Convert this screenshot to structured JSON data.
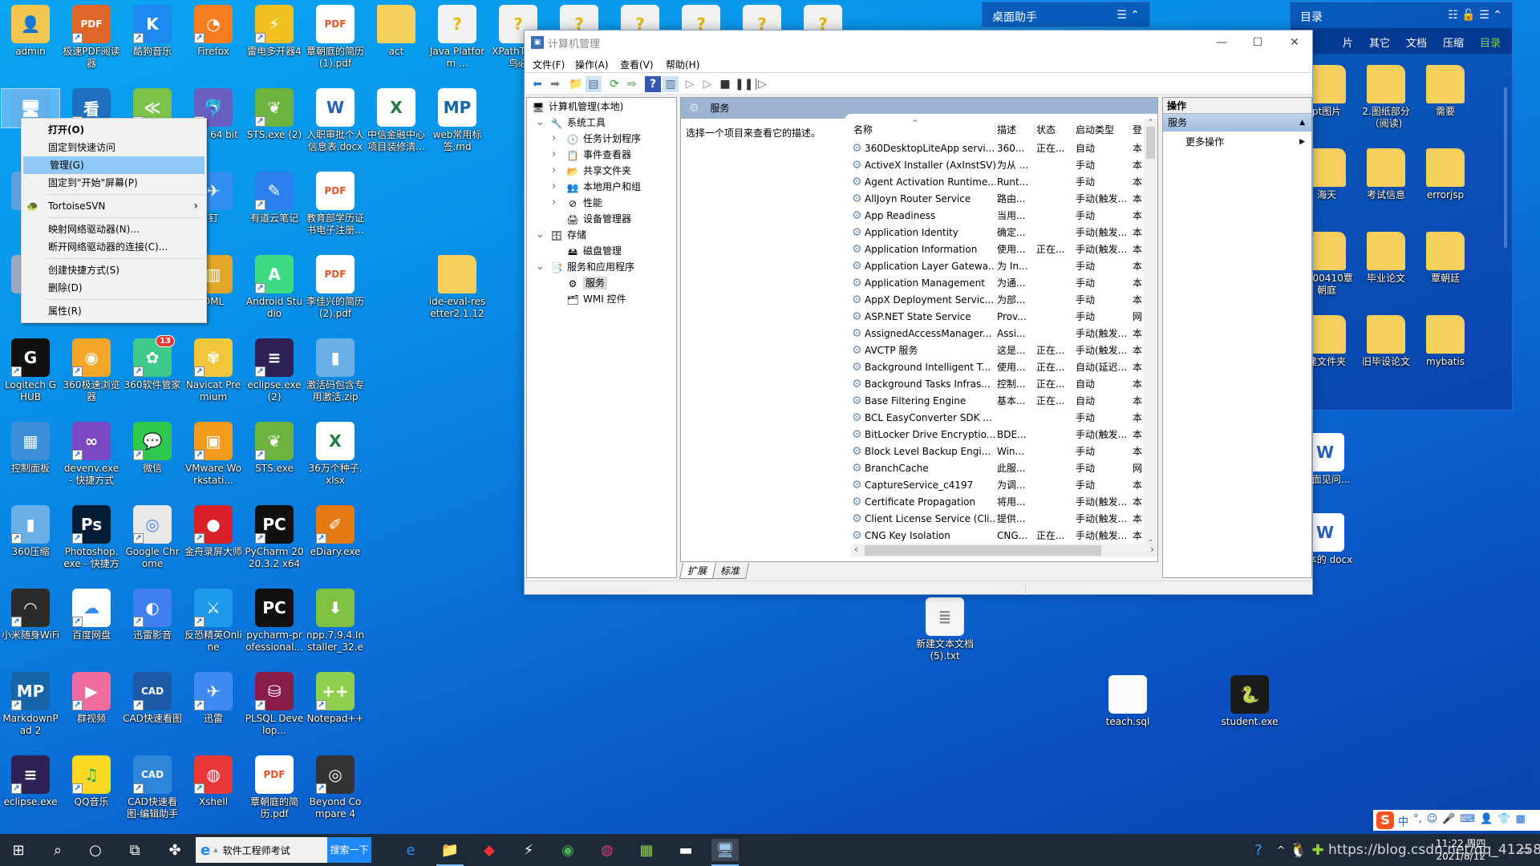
{
  "desktop": {
    "icons": [
      {
        "label": "admin",
        "icon": "user-folder-icon",
        "shortcut": false
      },
      {
        "label": "",
        "icon": "this-pc-icon",
        "shortcut": false,
        "selected": true
      },
      {
        "label": "",
        "icon": "network-icon",
        "shortcut": false
      },
      {
        "label": "",
        "icon": "recycle-bin-icon",
        "shortcut": false
      },
      {
        "label": "Logitech G HUB",
        "icon": "logitech-icon",
        "shortcut": true
      },
      {
        "label": "控制面板",
        "icon": "control-panel-icon",
        "shortcut": false
      },
      {
        "label": "360压缩",
        "icon": "archive-icon",
        "shortcut": true
      },
      {
        "label": "小米随身WiFi",
        "icon": "wifi-icon",
        "shortcut": true
      },
      {
        "label": "MarkdownPad 2",
        "icon": "markdownpad-icon",
        "shortcut": true
      },
      {
        "label": "eclipse.exe",
        "icon": "eclipse-icon",
        "shortcut": true
      },
      {
        "label": "极速PDF阅读器",
        "icon": "pdf-reader-icon",
        "shortcut": true
      },
      {
        "label": "",
        "icon": "image-viewer-icon",
        "shortcut": true
      },
      {
        "label": "360极速浏览器",
        "icon": "browser-360-icon",
        "shortcut": true
      },
      {
        "label": "devenv.exe - 快捷方式",
        "icon": "visual-studio-icon",
        "shortcut": true
      },
      {
        "label": "Photoshop.exe - 快捷方式",
        "icon": "photoshop-icon",
        "shortcut": true
      },
      {
        "label": "百度网盘",
        "icon": "baidu-pan-icon",
        "shortcut": true
      },
      {
        "label": "群视频",
        "icon": "video-icon",
        "shortcut": true
      },
      {
        "label": "QQ音乐",
        "icon": "qq-music-icon",
        "shortcut": true
      },
      {
        "label": "酷狗音乐",
        "icon": "kugou-icon",
        "shortcut": true
      },
      {
        "label": "",
        "icon": "app-icon",
        "shortcut": true
      },
      {
        "label": "360软件管家",
        "icon": "software-manager-icon",
        "shortcut": true,
        "badge": "13"
      },
      {
        "label": "微信",
        "icon": "wechat-icon",
        "shortcut": true
      },
      {
        "label": "Google Chrome",
        "icon": "chrome-icon",
        "shortcut": true
      },
      {
        "label": "迅雷影音",
        "icon": "xunlei-player-icon",
        "shortcut": true
      },
      {
        "label": "CAD快速看图",
        "icon": "cad-icon",
        "shortcut": true
      },
      {
        "label": "CAD快速看图-编辑助手",
        "icon": "cad-editor-icon",
        "shortcut": true
      },
      {
        "label": "Firefox",
        "icon": "firefox-icon",
        "shortcut": true
      },
      {
        "label": "og - 64 bit",
        "icon": "dolphin-icon",
        "shortcut": true
      },
      {
        "label": "钉",
        "icon": "dingtalk-icon",
        "shortcut": true
      },
      {
        "label": "DML",
        "icon": "database-icon",
        "shortcut": true
      },
      {
        "label": "Navicat Premium",
        "icon": "navicat-icon",
        "shortcut": true
      },
      {
        "label": "VMware Workstati...",
        "icon": "vmware-icon",
        "shortcut": true
      },
      {
        "label": "金舟录屏大师",
        "icon": "screen-recorder-icon",
        "shortcut": true
      },
      {
        "label": "反恐精英Online",
        "icon": "counter-strike-icon",
        "shortcut": true
      },
      {
        "label": "迅雷",
        "icon": "xunlei-icon",
        "shortcut": true
      },
      {
        "label": "Xshell",
        "icon": "xshell-icon",
        "shortcut": true
      },
      {
        "label": "雷电多开器4",
        "icon": "ldplayer-icon",
        "shortcut": true
      },
      {
        "label": "STS.exe (2)",
        "icon": "spring-icon",
        "shortcut": true
      },
      {
        "label": "有道云笔记",
        "icon": "youdao-note-icon",
        "shortcut": true
      },
      {
        "label": "Android Studio",
        "icon": "android-studio-icon",
        "shortcut": true
      },
      {
        "label": "eclipse.exe (2)",
        "icon": "eclipse-icon",
        "shortcut": true
      },
      {
        "label": "STS.exe",
        "icon": "spring-icon",
        "shortcut": true
      },
      {
        "label": "PyCharm 2020.3.2 x64",
        "icon": "pycharm-icon",
        "shortcut": true
      },
      {
        "label": "pycharm-professional...",
        "icon": "pycharm-installer-icon",
        "shortcut": false
      },
      {
        "label": "PLSQL Develop...",
        "icon": "plsql-icon",
        "shortcut": true
      },
      {
        "label": "覃朝庭的简历.pdf",
        "icon": "pdf-file-icon",
        "shortcut": false
      },
      {
        "label": "覃朝庭的简历(1).pdf",
        "icon": "pdf-file-icon",
        "shortcut": false
      },
      {
        "label": "入职审批个人信息表.docx",
        "icon": "word-file-icon",
        "shortcut": false
      },
      {
        "label": "教育部学历证书电子注册...",
        "icon": "pdf-file-icon",
        "shortcut": false
      },
      {
        "label": "李佳兴的简历(2).pdf",
        "icon": "pdf-file-icon",
        "shortcut": false
      },
      {
        "label": "激活码包含专用激活.zip",
        "icon": "archive-icon",
        "shortcut": false
      },
      {
        "label": "36万个种子.xlsx",
        "icon": "excel-file-icon",
        "shortcut": false
      },
      {
        "label": "eDiary.exe",
        "icon": "ediary-icon",
        "shortcut": true
      },
      {
        "label": "npp.7.9.4.Installer_32.exe",
        "icon": "notepadpp-installer-icon",
        "shortcut": false
      },
      {
        "label": "Notepad++",
        "icon": "notepadpp-icon",
        "shortcut": true
      },
      {
        "label": "Beyond Compare 4",
        "icon": "beyond-compare-icon",
        "shortcut": true
      },
      {
        "label": "act",
        "icon": "folder-icon",
        "shortcut": false
      },
      {
        "label": "中信金融中心项目装修清...",
        "icon": "excel-file-icon",
        "shortcut": false
      },
      {
        "label": "Java Platform ...",
        "icon": "help-file-icon",
        "shortcut": false
      },
      {
        "label": "web常用标签.md",
        "icon": "markdown-file-icon",
        "shortcut": false
      },
      {
        "label": "ide-eval-resetter2.1.12",
        "icon": "folder-icon",
        "shortcut": false
      },
      {
        "label": "XPathT l(菜鸟必",
        "icon": "help-file-icon",
        "shortcut": false
      },
      {
        "label": "",
        "icon": "help-file-icon",
        "shortcut": false
      },
      {
        "label": "",
        "icon": "help-file-icon",
        "shortcut": false
      },
      {
        "label": "",
        "icon": "help-file-icon",
        "shortcut": false
      },
      {
        "label": "",
        "icon": "help-file-icon",
        "shortcut": false
      },
      {
        "label": "",
        "icon": "help-file-icon",
        "shortcut": false
      },
      {
        "label": "新建文本文档(5).txt",
        "icon": "text-file-icon",
        "shortcut": false
      },
      {
        "label": "teach.sql",
        "icon": "blank-file-icon",
        "shortcut": false
      },
      {
        "label": "student.exe",
        "icon": "python-exe-icon",
        "shortcut": false
      },
      {
        "label": "op面见问...",
        "icon": "word-file-icon",
        "shortcut": false
      },
      {
        "label": "脚本的 docx",
        "icon": "word-file-icon",
        "shortcut": false
      }
    ]
  },
  "context_menu": {
    "items": [
      {
        "label": "打开(O)",
        "bold": true
      },
      {
        "label": "固定到快速访问"
      },
      {
        "label": "管理(G)",
        "highlighted": true
      },
      {
        "label": "固定到\"开始\"屏幕(P)"
      },
      {
        "separator": true
      },
      {
        "label": "TortoiseSVN",
        "submenu": true,
        "icon": "tortoisesvn-icon"
      },
      {
        "separator": true
      },
      {
        "label": "映射网络驱动器(N)..."
      },
      {
        "label": "断开网络驱动器的连接(C)..."
      },
      {
        "separator": true
      },
      {
        "label": "创建快捷方式(S)"
      },
      {
        "label": "删除(D)"
      },
      {
        "separator": true
      },
      {
        "label": "属性(R)"
      }
    ]
  },
  "fences": {
    "helper": {
      "title": "桌面助手"
    },
    "catalog": {
      "title": "目录",
      "tabs": [
        "片",
        "其它",
        "文档",
        "压缩",
        "目录"
      ],
      "active_tab": "目录",
      "active_color": "#7cd34a",
      "items": [
        "pt图片",
        "2.图纸部分（阅读)",
        "需要",
        "海天",
        "考试信息",
        "errorjsp",
        "1300410覃朝庭",
        "毕业论文",
        "覃朝廷",
        "建文件夹",
        "旧毕设论文",
        "mybatis"
      ]
    }
  },
  "window": {
    "title": "计算机管理",
    "menu": [
      "文件(F)",
      "操作(A)",
      "查看(V)",
      "帮助(H)"
    ],
    "tree": [
      {
        "label": "计算机管理(本地)",
        "level": 0,
        "icon": "computer-management-icon"
      },
      {
        "label": "系统工具",
        "level": 1,
        "expanded": true,
        "icon": "tools-icon"
      },
      {
        "label": "任务计划程序",
        "level": 2,
        "collapsed": true,
        "icon": "clock-icon"
      },
      {
        "label": "事件查看器",
        "level": 2,
        "collapsed": true,
        "icon": "event-viewer-icon"
      },
      {
        "label": "共享文件夹",
        "level": 2,
        "collapsed": true,
        "icon": "shared-folder-icon"
      },
      {
        "label": "本地用户和组",
        "level": 2,
        "collapsed": true,
        "icon": "users-icon"
      },
      {
        "label": "性能",
        "level": 2,
        "collapsed": true,
        "icon": "performance-icon"
      },
      {
        "label": "设备管理器",
        "level": 2,
        "icon": "device-manager-icon"
      },
      {
        "label": "存储",
        "level": 1,
        "expanded": true,
        "icon": "storage-icon"
      },
      {
        "label": "磁盘管理",
        "level": 2,
        "icon": "disk-icon"
      },
      {
        "label": "服务和应用程序",
        "level": 1,
        "expanded": true,
        "icon": "services-apps-icon"
      },
      {
        "label": "服务",
        "level": 2,
        "selected": true,
        "icon": "gear-icon"
      },
      {
        "label": "WMI 控件",
        "level": 2,
        "icon": "wmi-icon"
      }
    ],
    "center": {
      "header": "服务",
      "description": "选择一个项目来查看它的描述。",
      "columns": [
        "名称",
        "描述",
        "状态",
        "启动类型",
        "登"
      ],
      "rows": [
        [
          "360DesktopLiteApp servi...",
          "360...",
          "正在...",
          "自动",
          "本"
        ],
        [
          "ActiveX Installer (AxInstSV)",
          "为从 ...",
          "",
          "手动",
          "本"
        ],
        [
          "Agent Activation Runtime...",
          "Runt...",
          "",
          "手动",
          "本"
        ],
        [
          "AllJoyn Router Service",
          "路由...",
          "",
          "手动(触发...",
          "本"
        ],
        [
          "App Readiness",
          "当用...",
          "",
          "手动",
          "本"
        ],
        [
          "Application Identity",
          "确定...",
          "",
          "手动(触发...",
          "本"
        ],
        [
          "Application Information",
          "使用...",
          "正在...",
          "手动(触发...",
          "本"
        ],
        [
          "Application Layer Gatewa...",
          "为 In...",
          "",
          "手动",
          "本"
        ],
        [
          "Application Management",
          "为通...",
          "",
          "手动",
          "本"
        ],
        [
          "AppX Deployment Servic...",
          "为部...",
          "",
          "手动",
          "本"
        ],
        [
          "ASP.NET State Service",
          "Prov...",
          "",
          "手动",
          "网"
        ],
        [
          "AssignedAccessManager...",
          "Assi...",
          "",
          "手动(触发...",
          "本"
        ],
        [
          "AVCTP 服务",
          "这是...",
          "正在...",
          "手动(触发...",
          "本"
        ],
        [
          "Background Intelligent T...",
          "使用...",
          "正在...",
          "自动(延迟...",
          "本"
        ],
        [
          "Background Tasks Infras...",
          "控制...",
          "正在...",
          "自动",
          "本"
        ],
        [
          "Base Filtering Engine",
          "基本...",
          "正在...",
          "自动",
          "本"
        ],
        [
          "BCL EasyConverter SDK ...",
          "",
          "",
          "手动",
          "本"
        ],
        [
          "BitLocker Drive Encryptio...",
          "BDE...",
          "",
          "手动(触发...",
          "本"
        ],
        [
          "Block Level Backup Engi...",
          "Win...",
          "",
          "手动",
          "本"
        ],
        [
          "BranchCache",
          "此服...",
          "",
          "手动",
          "网"
        ],
        [
          "CaptureService_c4197",
          "为调...",
          "",
          "手动",
          "本"
        ],
        [
          "Certificate Propagation",
          "将用...",
          "",
          "手动(触发...",
          "本"
        ],
        [
          "Client License Service (Cli...",
          "提供...",
          "",
          "手动(触发...",
          "本"
        ],
        [
          "CNG Key Isolation",
          "CNG...",
          "正在...",
          "手动(触发...",
          "本"
        ]
      ],
      "tabs": [
        "扩展",
        "标准"
      ],
      "active_tab": "扩展"
    },
    "actions": {
      "header": "操作",
      "section": "服务",
      "more": "更多操作"
    }
  },
  "taskbar": {
    "search_text": "软件工程师考试",
    "search_button": "搜索一下",
    "search_button_color": "#1e88f5",
    "pinned": [
      "edge-icon",
      "file-explorer-icon",
      "diamond-app-icon",
      "lightning-app-icon",
      "chrome-icon",
      "media-app-icon",
      "spreadsheet-app-icon",
      "terminal-icon",
      "computer-management-icon"
    ],
    "time": "11:22 周四",
    "date": "2021/8/12",
    "watermark": "https://blog.csdn.net/qq_41258451",
    "ime": [
      "中",
      "°,",
      "☺",
      "🎤",
      "⌨",
      "👤",
      "👕",
      "▦"
    ]
  }
}
